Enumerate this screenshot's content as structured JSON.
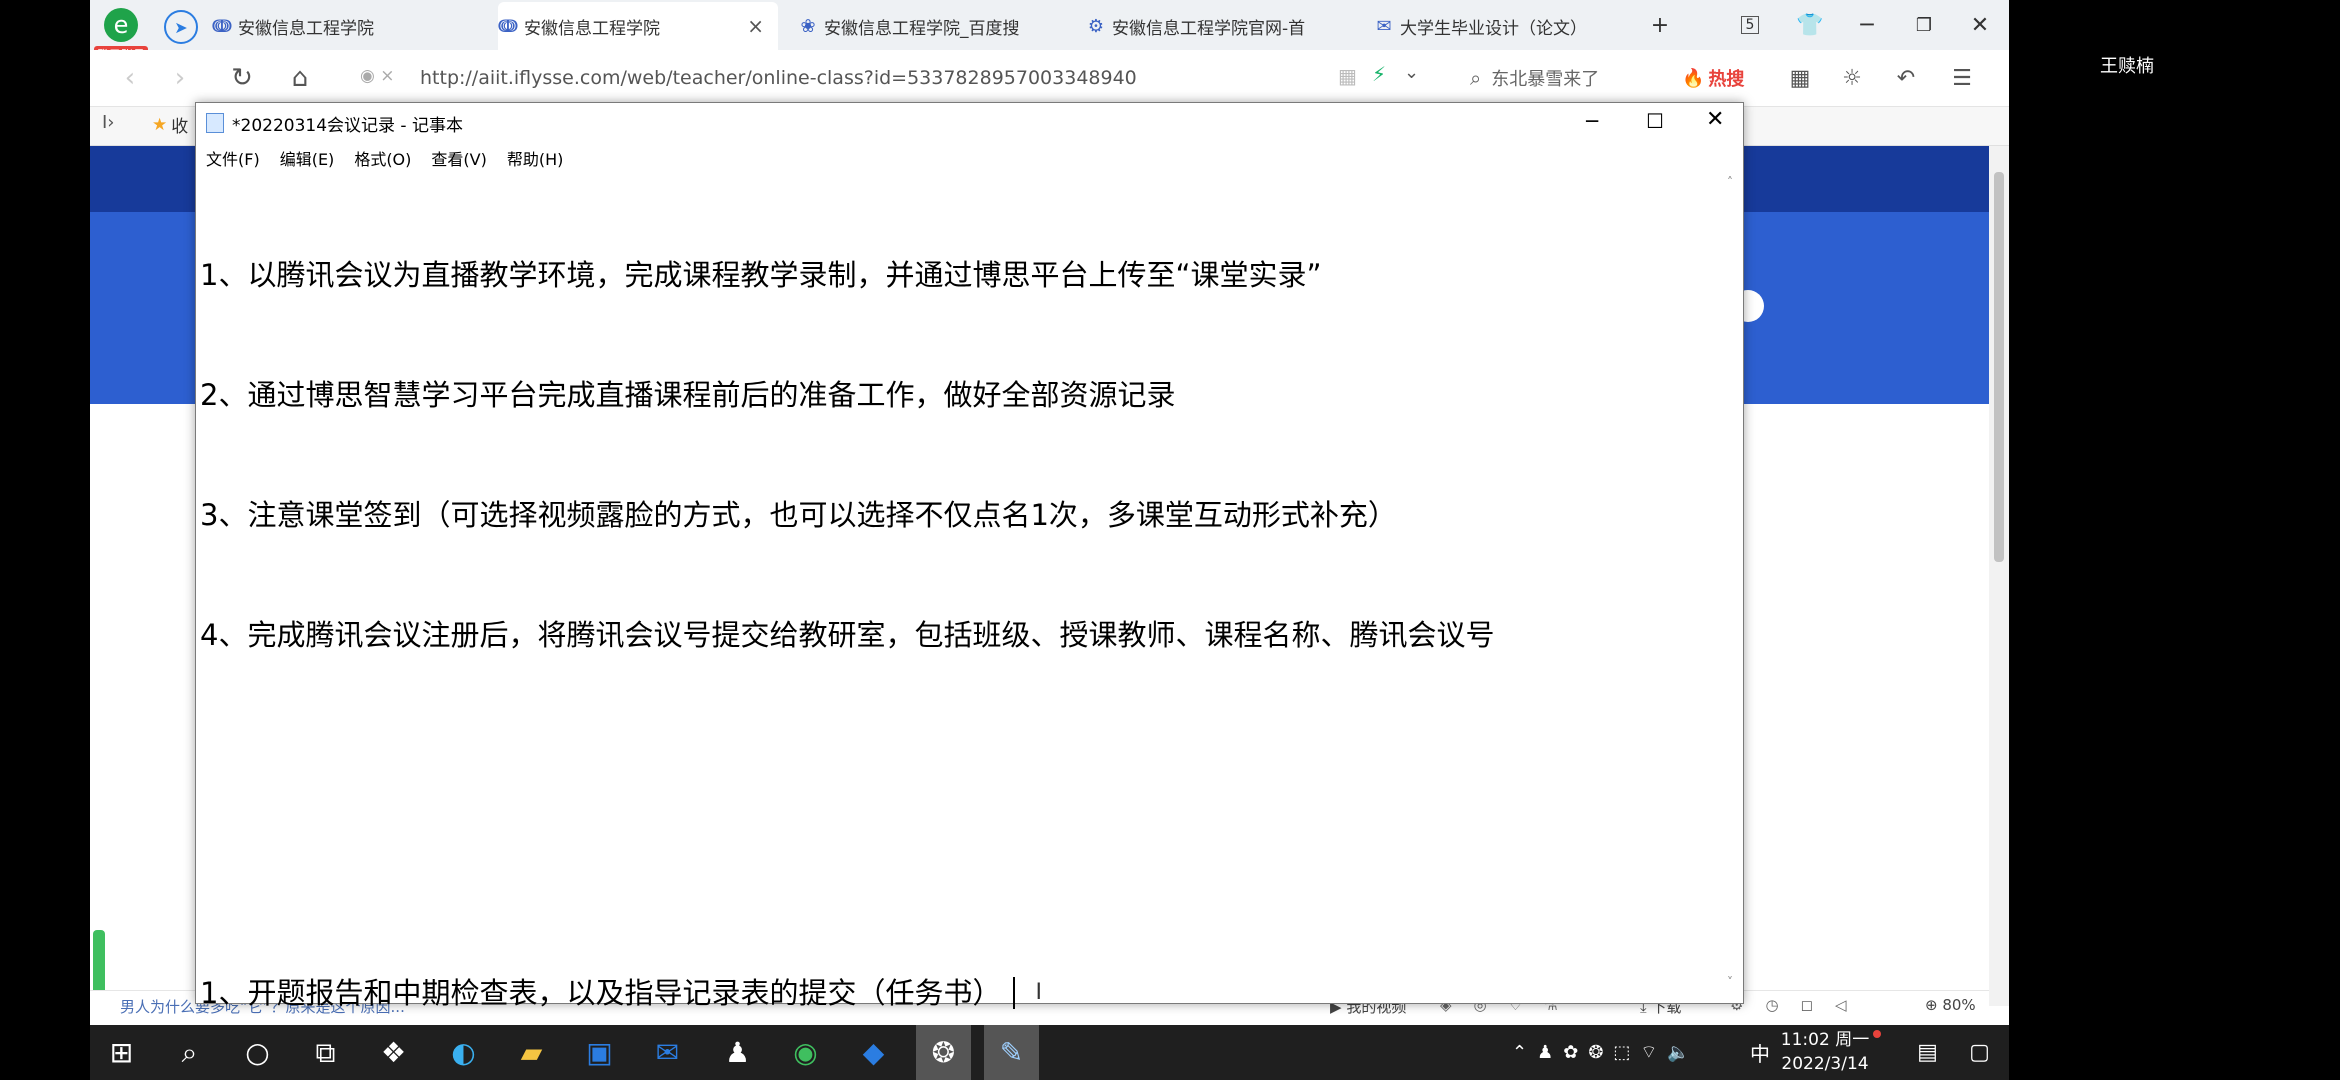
{
  "user_name": "王赎楠",
  "browser": {
    "login_badge": "登录账号",
    "tabs": [
      {
        "label": "安徽信息工程学院",
        "icon": "link-icon",
        "active": false
      },
      {
        "label": "安徽信息工程学院",
        "icon": "link-icon",
        "active": true
      },
      {
        "label": "安徽信息工程学院_百度搜",
        "icon": "paw-icon",
        "active": false
      },
      {
        "label": "安徽信息工程学院官网-首",
        "icon": "gear-icon",
        "active": false
      },
      {
        "label": "大学生毕业设计（论文）",
        "icon": "cap-icon",
        "active": false
      }
    ],
    "new_tab": "+",
    "tab_count": "5",
    "url": "http://aiit.iflysse.com/web/teacher/online-class?id=5337828957003348940",
    "search_placeholder": "东北暴雪来了",
    "hot_search": "热搜",
    "fav_label": "收",
    "status_link": "男人为什么要多吃“它”？原来是这个原因...",
    "status_right": {
      "my_video": "我的视频",
      "download": "下载",
      "zoom": "80%"
    }
  },
  "notepad": {
    "title": "*20220314会议记录 - 记事本",
    "menu": [
      "文件(F)",
      "编辑(E)",
      "格式(O)",
      "查看(V)",
      "帮助(H)"
    ],
    "lines": [
      "1、以腾讯会议为直播教学环境，完成课程教学录制，并通过博思平台上传至“课堂实录”",
      "2、通过博思智慧学习平台完成直播课程前后的准备工作，做好全部资源记录",
      "3、注意课堂签到（可选择视频露脸的方式，也可以选择不仅点名1次，多课堂互动形式补充）",
      "4、完成腾讯会议注册后，将腾讯会议号提交给教研室，包括班级、授课教师、课程名称、腾讯会议号",
      "",
      "",
      "1、开题报告和中期检查表，以及指导记录表的提交（任务书）"
    ]
  },
  "taskbar": {
    "ime": "中",
    "time": "11:02 周一",
    "date": "2022/3/14"
  }
}
